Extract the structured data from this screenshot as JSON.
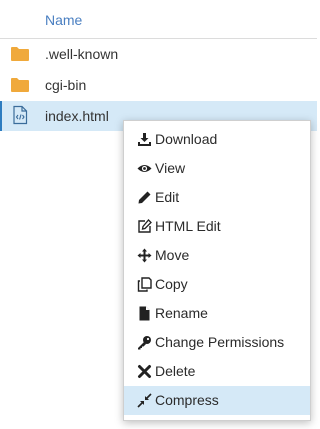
{
  "table": {
    "column_name": "Name",
    "rows": [
      {
        "name": ".well-known",
        "icon": "folder-icon"
      },
      {
        "name": "cgi-bin",
        "icon": "folder-icon"
      },
      {
        "name": "index.html",
        "icon": "html-file-icon",
        "selected": true
      }
    ]
  },
  "context_menu": {
    "items": [
      {
        "label": "Download",
        "icon": "download-icon"
      },
      {
        "label": "View",
        "icon": "eye-icon"
      },
      {
        "label": "Edit",
        "icon": "pencil-icon"
      },
      {
        "label": "HTML Edit",
        "icon": "edit-square-icon"
      },
      {
        "label": "Move",
        "icon": "move-arrows-icon"
      },
      {
        "label": "Copy",
        "icon": "copy-icon"
      },
      {
        "label": "Rename",
        "icon": "file-icon"
      },
      {
        "label": "Change Permissions",
        "icon": "key-icon"
      },
      {
        "label": "Delete",
        "icon": "x-icon"
      },
      {
        "label": "Compress",
        "icon": "compress-icon",
        "highlighted": true
      }
    ]
  },
  "colors": {
    "header_text": "#4a7fc1",
    "folder": "#f0a93b",
    "selected_row": "#d5e9f7",
    "selected_border": "#2d7cc0",
    "menu_hover": "#d5e9f7"
  }
}
